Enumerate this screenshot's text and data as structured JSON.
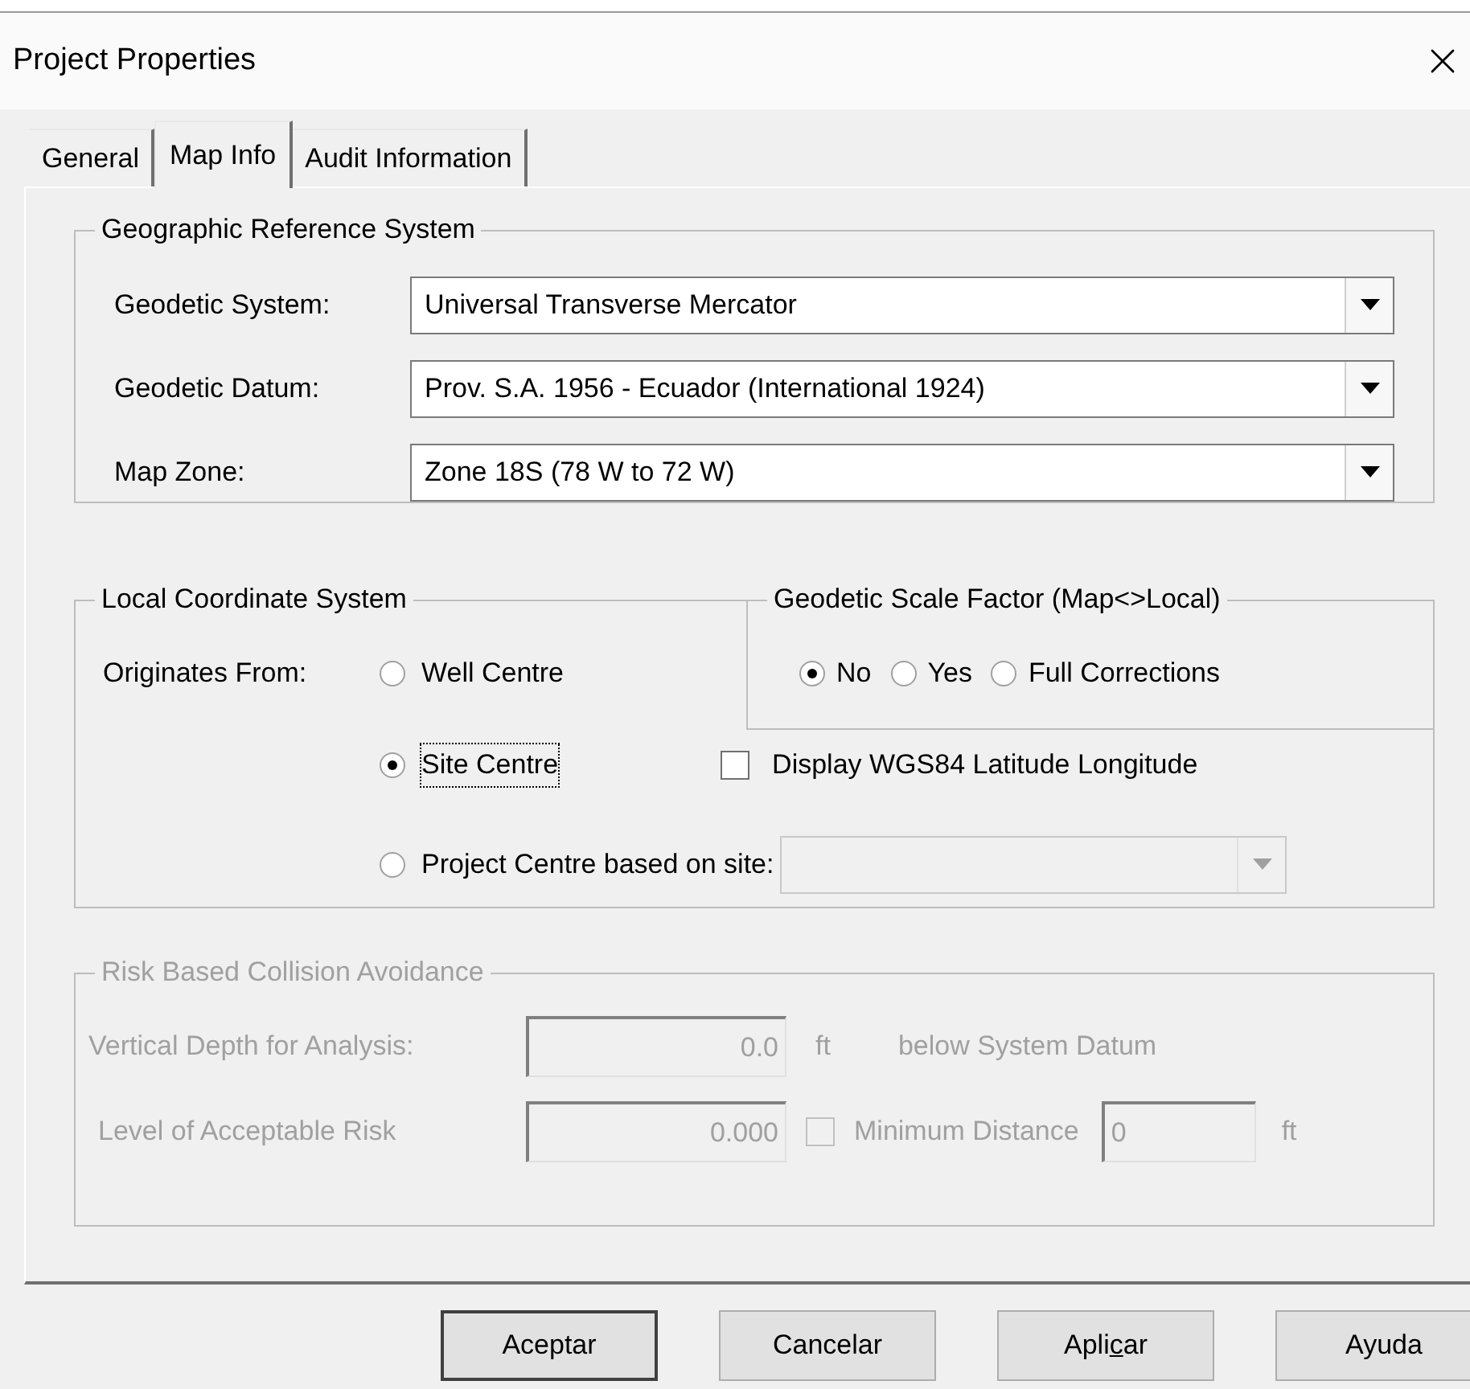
{
  "window": {
    "title": "Project Properties"
  },
  "tabs": [
    {
      "label": "General",
      "selected": false
    },
    {
      "label": "Map Info",
      "selected": true
    },
    {
      "label": "Audit Information",
      "selected": false
    }
  ],
  "geographic_reference_system": {
    "title": "Geographic Reference System",
    "fields": [
      {
        "label": "Geodetic System:",
        "value": "Universal Transverse Mercator"
      },
      {
        "label": "Geodetic Datum:",
        "value": "Prov. S.A. 1956 - Ecuador (International 1924)"
      },
      {
        "label": "Map Zone:",
        "value": "Zone 18S (78 W to 72 W)"
      }
    ]
  },
  "local_coordinate_system": {
    "title": "Local Coordinate System",
    "originates_label": "Originates From:",
    "options": [
      {
        "label": "Well Centre",
        "selected": false,
        "focused": false
      },
      {
        "label": "Site Centre",
        "selected": true,
        "focused": true
      },
      {
        "label": "Project Centre based on site:",
        "selected": false,
        "focused": false
      }
    ],
    "site_dropdown": {
      "disabled": true
    }
  },
  "geodetic_scale_factor": {
    "title": "Geodetic Scale Factor (Map<>Local)",
    "options": [
      {
        "label": "No",
        "selected": true
      },
      {
        "label": "Yes",
        "selected": false
      },
      {
        "label": "Full Corrections",
        "selected": false
      }
    ]
  },
  "display_wgs84": {
    "label": "Display WGS84 Latitude Longitude",
    "checked": false
  },
  "risk_based_collision_avoidance": {
    "title": "Risk Based Collision Avoidance",
    "disabled": true,
    "vertical_depth": {
      "label": "Vertical Depth for Analysis:",
      "value": "0.0",
      "unit": "ft",
      "note": "below System Datum"
    },
    "acceptable_risk": {
      "label": "Level of Acceptable Risk",
      "value": "0.000",
      "minimum_distance": {
        "label": "Minimum Distance",
        "checked": false,
        "value": "0",
        "unit": "ft"
      }
    }
  },
  "buttons": [
    {
      "label_parts": [
        "Aceptar"
      ],
      "default": true
    },
    {
      "label_parts": [
        "Cancelar"
      ],
      "default": false
    },
    {
      "label_parts": [
        "Apli",
        "c",
        "ar"
      ],
      "default": false
    },
    {
      "label_parts": [
        "Ayuda"
      ],
      "default": false
    }
  ]
}
